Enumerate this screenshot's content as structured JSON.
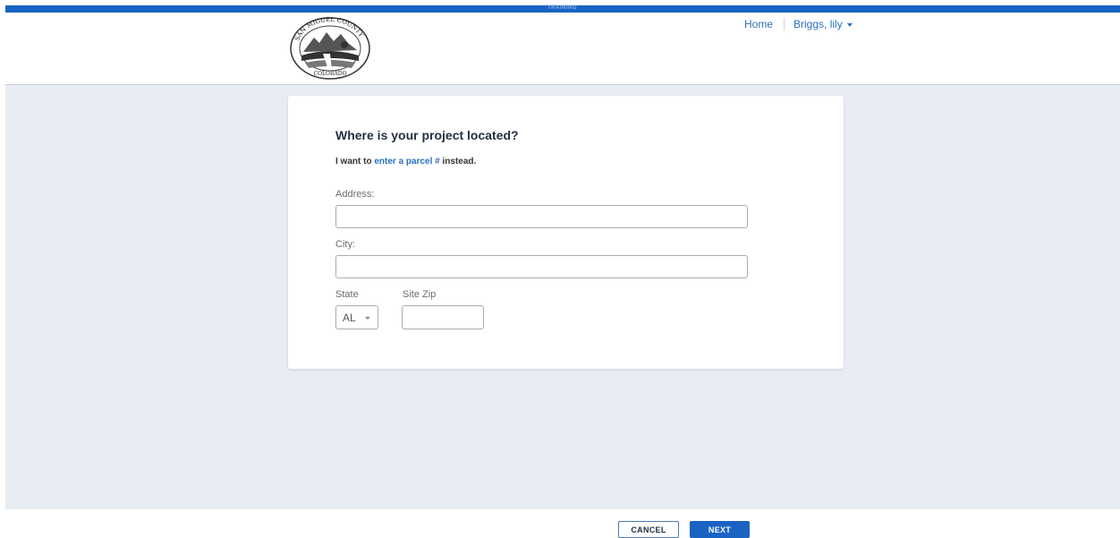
{
  "top_bar": {
    "label": "TRAINING"
  },
  "header": {
    "logo_text_top": "SAN MIGUEL COUNTY",
    "logo_text_bottom": "COLORADO",
    "nav": {
      "home": "Home",
      "user": "Briggs, lily"
    }
  },
  "form": {
    "title": "Where is your project located?",
    "alt_prefix": "I want to ",
    "alt_link": "enter a parcel #",
    "alt_suffix": " instead.",
    "address_label": "Address:",
    "address_value": "",
    "city_label": "City:",
    "city_value": "",
    "state_label": "State",
    "state_value": "AL",
    "zip_label": "Site Zip",
    "zip_value": ""
  },
  "footer": {
    "cancel_label": "CANCEL",
    "next_label": "NEXT"
  },
  "colors": {
    "brand": "#1a63c3",
    "background": "#e8edf4",
    "link": "#2870bd"
  }
}
